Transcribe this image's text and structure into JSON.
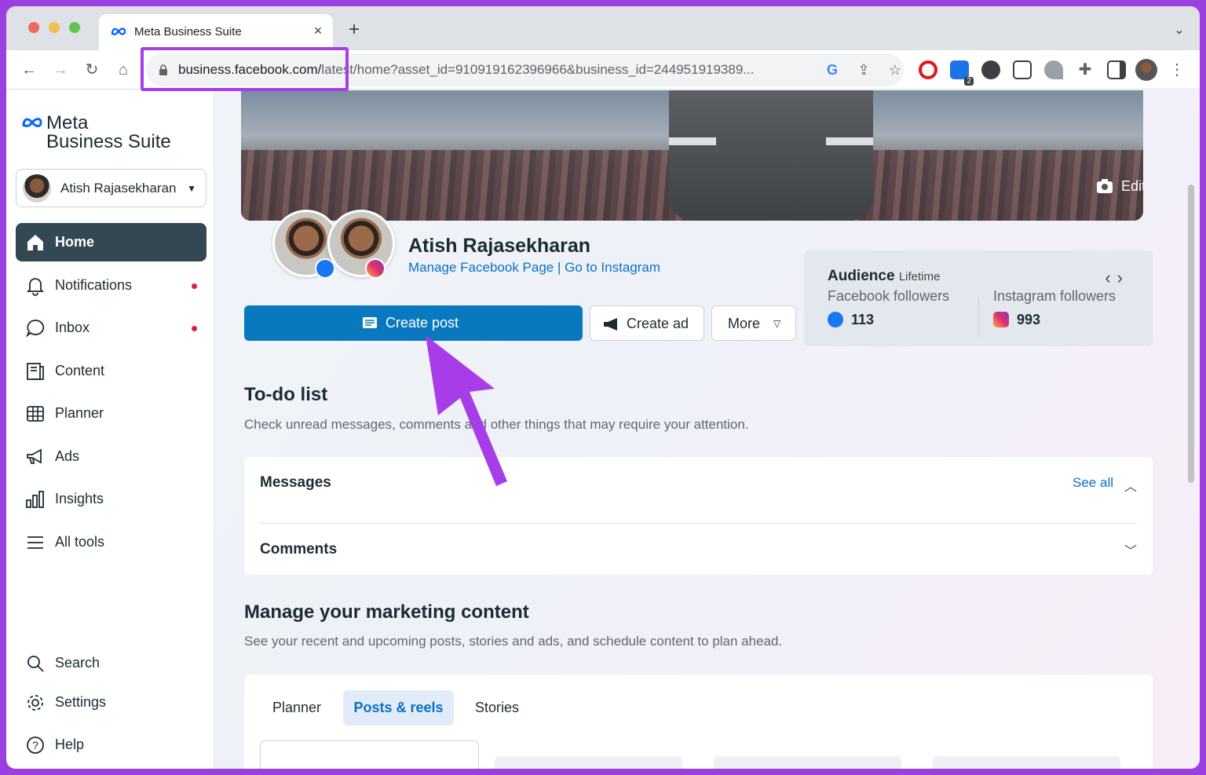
{
  "browser": {
    "tab_title": "Meta Business Suite",
    "tab_close": "×",
    "new_tab": "+",
    "url_host": "business.facebook.com/",
    "url_rest": "latest/home?asset_id=910919162396966&business_id=244951919389...",
    "badge_count": "2"
  },
  "brand": {
    "line1": "Meta",
    "line2": "Business Suite"
  },
  "account": {
    "name": "Atish Rajasekharan"
  },
  "nav": {
    "home": "Home",
    "notifications": "Notifications",
    "inbox": "Inbox",
    "content": "Content",
    "planner": "Planner",
    "ads": "Ads",
    "insights": "Insights",
    "all_tools": "All tools",
    "search": "Search",
    "settings": "Settings",
    "help": "Help"
  },
  "cover": {
    "edit_label": "Edit cover photo"
  },
  "profile": {
    "name": "Atish Rajasekharan",
    "manage_link": "Manage Facebook Page",
    "separator": " | ",
    "instagram_link": "Go to Instagram"
  },
  "actions": {
    "create_post": "Create post",
    "create_ad": "Create ad",
    "more": "More"
  },
  "audience": {
    "title": "Audience",
    "period": "Lifetime",
    "fb_label": "Facebook followers",
    "fb_value": "113",
    "ig_label": "Instagram followers",
    "ig_value": "993"
  },
  "todo": {
    "title": "To-do list",
    "subtitle": "Check unread messages, comments and other things that may require your attention.",
    "messages": "Messages",
    "see_all": "See all",
    "comments": "Comments"
  },
  "marketing": {
    "title": "Manage your marketing content",
    "subtitle": "See your recent and upcoming posts, stories and ads, and schedule content to plan ahead.",
    "tabs": [
      "Planner",
      "Posts & reels",
      "Stories"
    ]
  },
  "colors": {
    "highlight": "#a73ce8",
    "primary_button": "#0a78be",
    "active_nav": "#344854",
    "link": "#0a6fc2"
  }
}
